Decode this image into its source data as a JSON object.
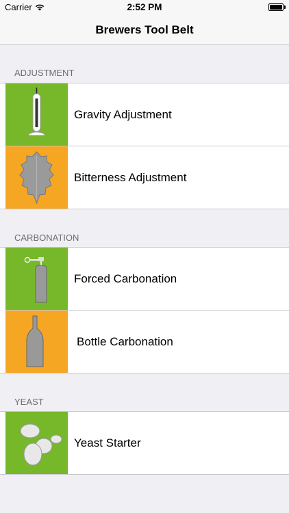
{
  "status_bar": {
    "carrier": "Carrier",
    "time": "2:52 PM",
    "wifi_icon": "wifi-icon",
    "battery_icon": "battery-icon"
  },
  "nav": {
    "title": "Brewers Tool Belt"
  },
  "colors": {
    "green": "#76b82a",
    "orange": "#f5a623",
    "icon_gray": "#a0a0a0"
  },
  "sections": [
    {
      "header": "ADJUSTMENT",
      "items": [
        {
          "label": "Gravity Adjustment",
          "icon": "hydrometer-icon",
          "tile_color": "green"
        },
        {
          "label": "Bitterness Adjustment",
          "icon": "hop-icon",
          "tile_color": "orange"
        }
      ]
    },
    {
      "header": "CARBONATION",
      "items": [
        {
          "label": "Forced Carbonation",
          "icon": "co2-tank-icon",
          "tile_color": "green"
        },
        {
          "label": "Bottle Carbonation",
          "icon": "bottle-icon",
          "tile_color": "orange"
        }
      ]
    },
    {
      "header": "YEAST",
      "items": [
        {
          "label": "Yeast Starter",
          "icon": "yeast-cells-icon",
          "tile_color": "green"
        }
      ]
    }
  ]
}
